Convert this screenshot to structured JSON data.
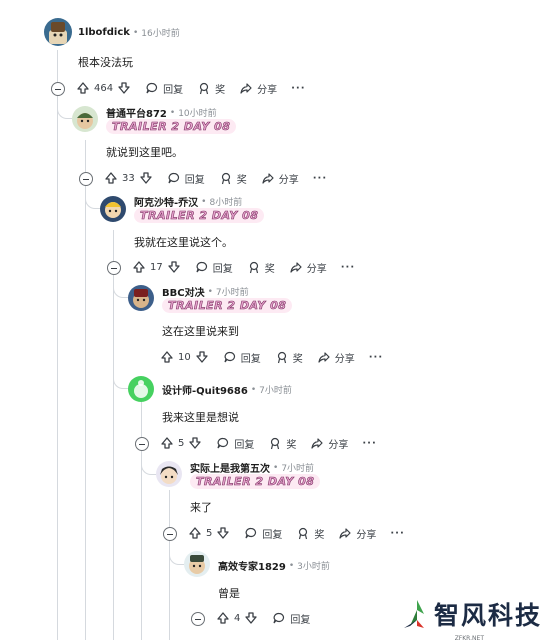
{
  "actions": {
    "reply": "回复",
    "award": "奖",
    "share": "分享",
    "more": "···"
  },
  "flair": "TRAILER 2 DAY 08",
  "comments": [
    {
      "author": "1lbofdick",
      "time": "16小时前",
      "body": "根本没法玩",
      "score": "464",
      "has_flair": false
    },
    {
      "author": "普通平台872",
      "time": "10小时前",
      "body": "就说到这里吧。",
      "score": "33",
      "has_flair": true
    },
    {
      "author": "阿克沙特-乔汉",
      "time": "8小时前",
      "body": "我就在这里说这个。",
      "score": "17",
      "has_flair": true
    },
    {
      "author": "BBC对决",
      "time": "7小时前",
      "body": "这在这里说来到",
      "score": "10",
      "has_flair": true
    },
    {
      "author": "设计师-Quit9686",
      "time": "7小时前",
      "body": "我来这里是想说",
      "score": "5",
      "has_flair": false
    },
    {
      "author": "实际上是我第五次",
      "time": "7小时前",
      "body": "来了",
      "score": "5",
      "has_flair": true
    },
    {
      "author": "高效专家1829",
      "time": "3小时前",
      "body": "曾是",
      "score": "4",
      "has_flair": false
    }
  ],
  "watermark": {
    "text": "智风科技",
    "sub": "ZFKR.NET"
  }
}
